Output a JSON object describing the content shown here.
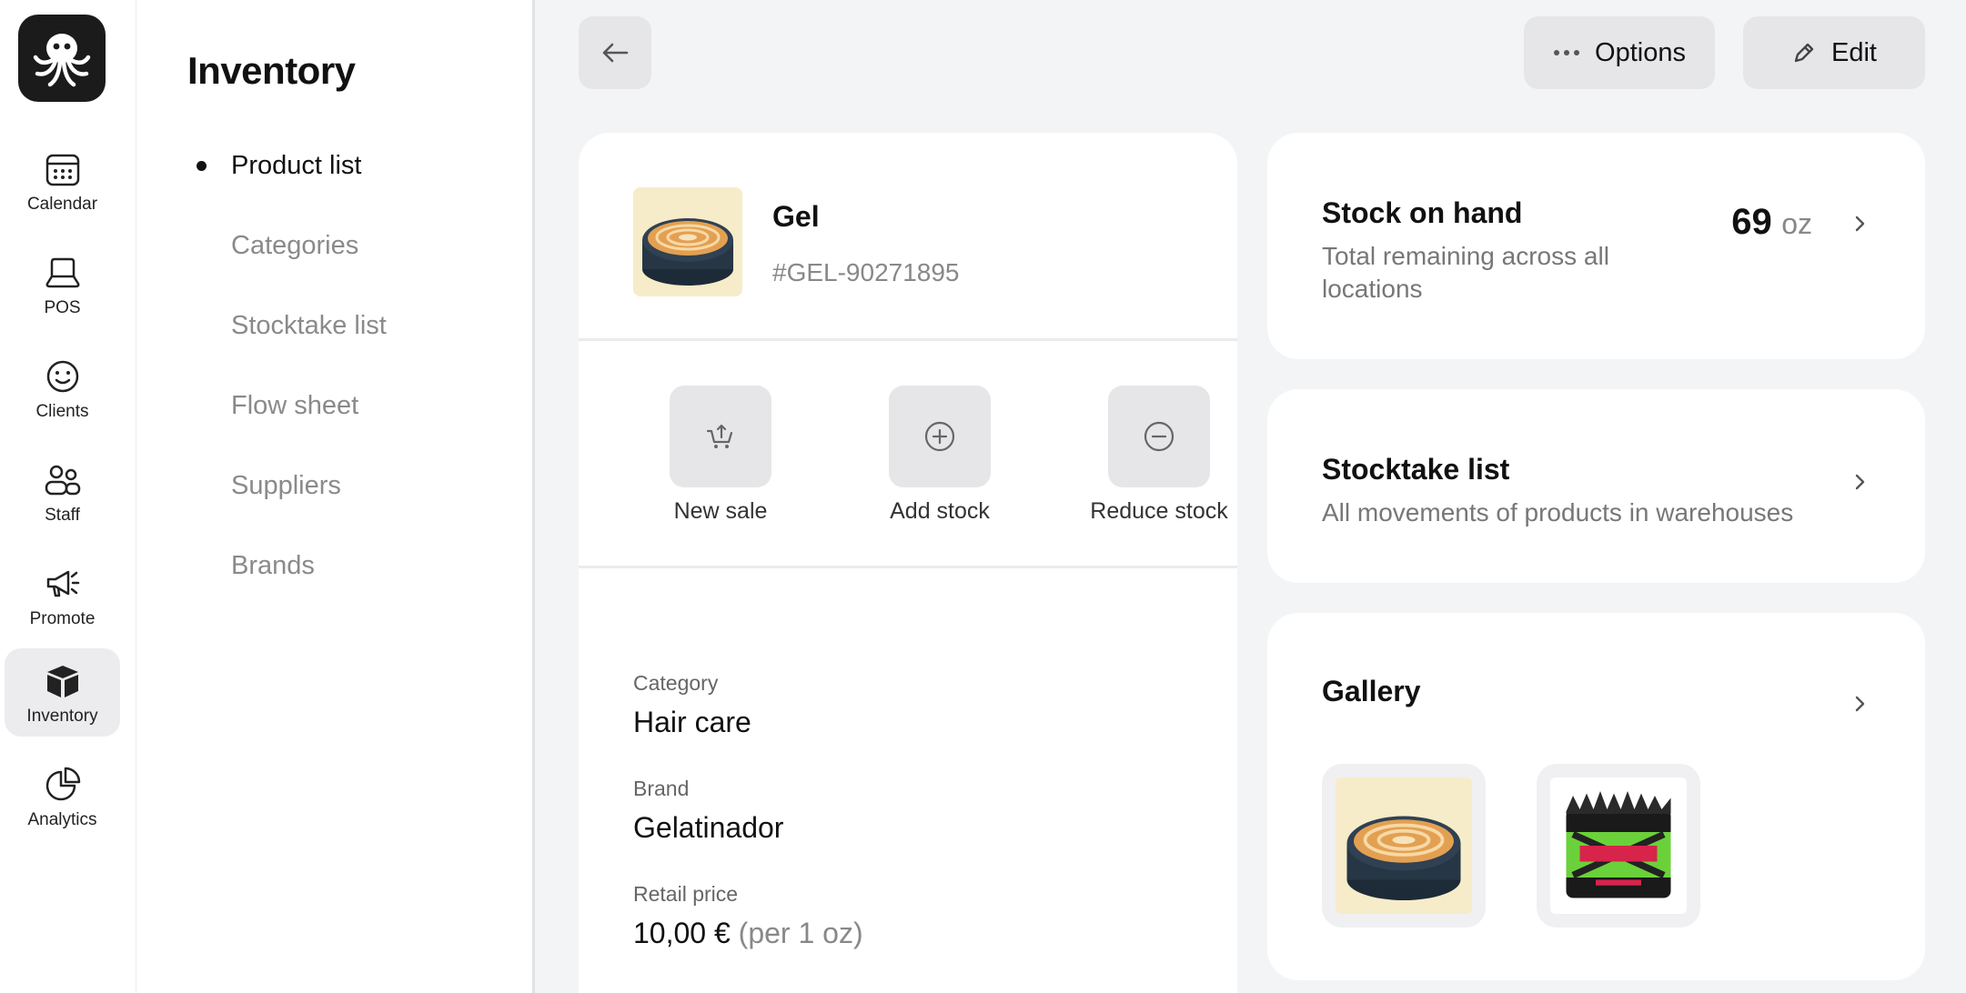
{
  "rail": {
    "items": [
      {
        "label": "Calendar",
        "icon": "calendar-icon"
      },
      {
        "label": "POS",
        "icon": "pos-icon"
      },
      {
        "label": "Clients",
        "icon": "smiley-icon"
      },
      {
        "label": "Staff",
        "icon": "staff-icon"
      },
      {
        "label": "Promote",
        "icon": "megaphone-icon"
      },
      {
        "label": "Inventory",
        "icon": "box-icon",
        "active": true
      },
      {
        "label": "Analytics",
        "icon": "pie-chart-icon"
      }
    ]
  },
  "subnav": {
    "title": "Inventory",
    "items": [
      {
        "label": "Product list",
        "active": true
      },
      {
        "label": "Categories"
      },
      {
        "label": "Stocktake list"
      },
      {
        "label": "Flow sheet"
      },
      {
        "label": "Suppliers"
      },
      {
        "label": "Brands"
      }
    ]
  },
  "topbar": {
    "options_label": "Options",
    "edit_label": "Edit"
  },
  "product": {
    "name": "Gel",
    "sku": "#GEL-90271895",
    "actions": [
      {
        "label": "New sale",
        "icon": "cart-upload-icon"
      },
      {
        "label": "Add stock",
        "icon": "plus-circle-icon"
      },
      {
        "label": "Reduce stock",
        "icon": "minus-circle-icon"
      }
    ],
    "fields": [
      {
        "label": "Category",
        "value": "Hair care"
      },
      {
        "label": "Brand",
        "value": "Gelatinador"
      },
      {
        "label": "Retail price",
        "value": "10,00 €",
        "suffix": "(per 1 oz)"
      }
    ]
  },
  "stock": {
    "title": "Stock on hand",
    "subtitle_line1": "Total remaining across all",
    "subtitle_line2": "locations",
    "amount": "69",
    "unit": "oz"
  },
  "stocktake": {
    "title": "Stocktake list",
    "subtitle": "All movements of products in warehouses"
  },
  "gallery": {
    "title": "Gallery"
  },
  "colors": {
    "background": "#f3f4f6",
    "card": "#ffffff",
    "button": "#e6e6e8",
    "muted_text": "#8a8a8a"
  }
}
